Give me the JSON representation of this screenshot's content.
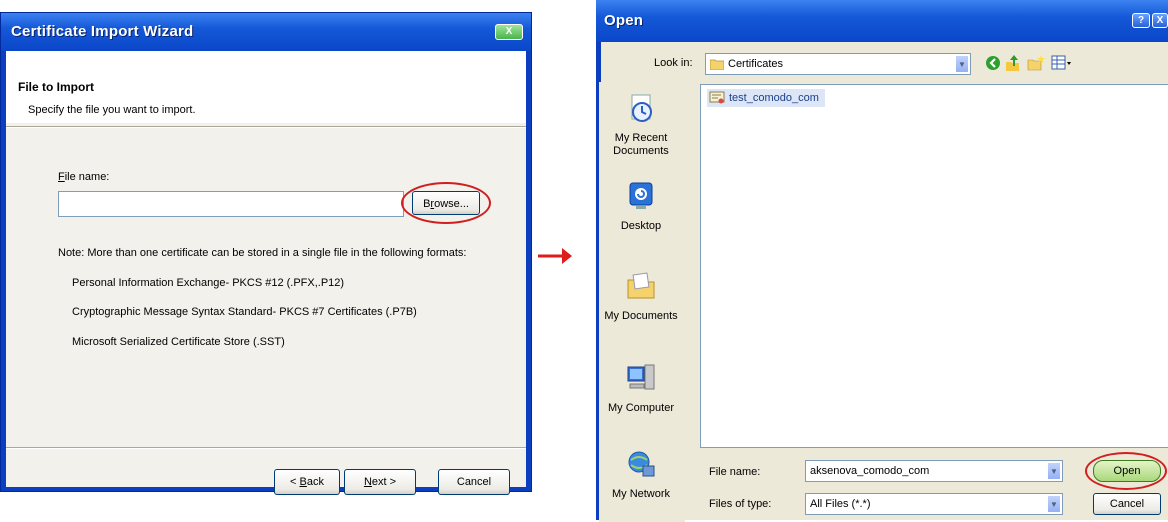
{
  "wizard": {
    "title": "Certificate Import Wizard",
    "close_label": "X",
    "header_title": "File to Import",
    "header_subtitle": "Specify the file you want to import.",
    "file_name_label_key": "F",
    "file_name_label_rest": "ile name:",
    "file_name_value": "",
    "browse_key": "r",
    "browse_pre": "B",
    "browse_post": "owse...",
    "note": "Note:  More than one certificate can be stored in a single file in the following formats:",
    "formats": [
      "Personal Information Exchange- PKCS #12 (.PFX,.P12)",
      "Cryptographic Message Syntax Standard- PKCS #7 Certificates (.P7B)",
      "Microsoft Serialized Certificate Store (.SST)"
    ],
    "back_pre": "< ",
    "back_key": "B",
    "back_post": "ack",
    "next_key": "N",
    "next_post": "ext >",
    "cancel_label": "Cancel"
  },
  "open_dialog": {
    "title": "Open",
    "help_label": "?",
    "close_label": "X",
    "look_in_label": "Look in:",
    "look_in_value": "Certificates",
    "places": [
      {
        "label": "My Recent Documents",
        "icon": "recent-documents-icon"
      },
      {
        "label": "Desktop",
        "icon": "desktop-icon"
      },
      {
        "label": "My Documents",
        "icon": "my-documents-icon"
      },
      {
        "label": "My Computer",
        "icon": "my-computer-icon"
      },
      {
        "label": "My Network",
        "icon": "my-network-icon"
      }
    ],
    "files": [
      {
        "name": "test_comodo_com",
        "icon": "certificate-file-icon"
      }
    ],
    "file_name_label": "File name:",
    "file_name_value": "aksenova_comodo_com",
    "files_of_type_label": "Files of type:",
    "files_of_type_value": "All Files (*.*)",
    "open_label": "Open",
    "cancel_label": "Cancel"
  },
  "colors": {
    "highlight_ring": "#d11e1e",
    "xp_title_blue": "#0a47c8",
    "arrow": "#e01b1b"
  }
}
